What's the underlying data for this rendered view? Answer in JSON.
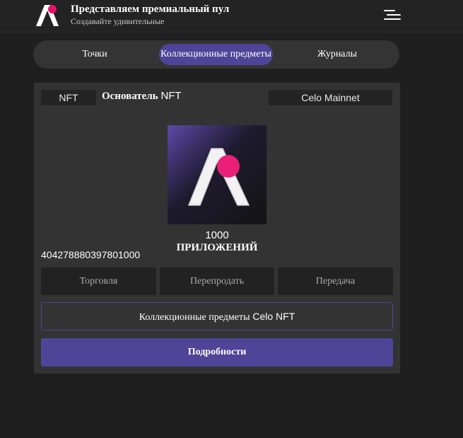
{
  "header": {
    "title": "Представляем премиальный пул",
    "subtitle": "Создавайте удивительные",
    "logo_icon": "app-logo-a-icon",
    "menu_icon": "hamburger-menu-icon"
  },
  "tabs": [
    {
      "label": "Точки",
      "active": false
    },
    {
      "label": "Коллекционные предметы",
      "active": true
    },
    {
      "label": "Журналы",
      "active": false
    }
  ],
  "card": {
    "type_chip": "NFT",
    "title_word": "Основатель",
    "title_nft": "NFT",
    "network": "Celo Mainnet",
    "image_icon": "nft-logo-artwork",
    "count": "1000",
    "count_label": "ПРИЛОЖЕНИЙ",
    "token_id": "404278880397801000",
    "actions": [
      "Торговля",
      "Перепродать",
      "Передача"
    ],
    "collection_label_word": "Коллекционные предметы",
    "collection_label_rest": "Celo NFT",
    "details_button": "Подробности"
  },
  "colors": {
    "accent": "#4f4498",
    "brand_pink": "#e8126c",
    "background": "#1f1f1f",
    "card": "#333333"
  }
}
